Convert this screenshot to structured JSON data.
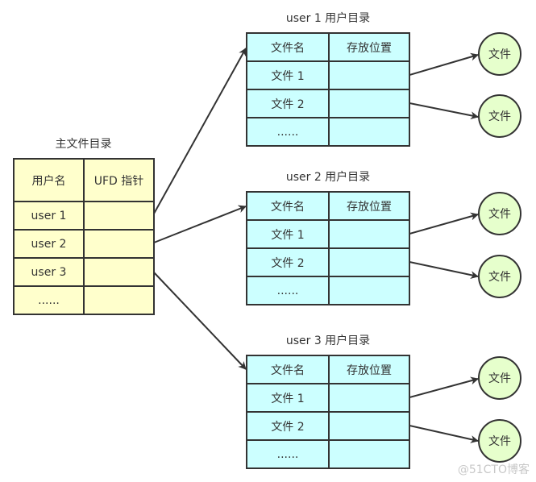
{
  "mfd": {
    "title": "主文件目录",
    "headers": [
      "用户名",
      "UFD 指针"
    ],
    "rows": [
      [
        "user 1",
        ""
      ],
      [
        "user 2",
        ""
      ],
      [
        "user 3",
        ""
      ],
      [
        "......",
        ""
      ]
    ]
  },
  "ufds": [
    {
      "title": "user 1 用户目录",
      "headers": [
        "文件名",
        "存放位置"
      ],
      "rows": [
        [
          "文件 1",
          ""
        ],
        [
          "文件 2",
          ""
        ],
        [
          "......",
          ""
        ]
      ],
      "files": [
        "文件",
        "文件"
      ]
    },
    {
      "title": "user 2 用户目录",
      "headers": [
        "文件名",
        "存放位置"
      ],
      "rows": [
        [
          "文件 1",
          ""
        ],
        [
          "文件 2",
          ""
        ],
        [
          "......",
          ""
        ]
      ],
      "files": [
        "文件",
        "文件"
      ]
    },
    {
      "title": "user 3 用户目录",
      "headers": [
        "文件名",
        "存放位置"
      ],
      "rows": [
        [
          "文件 1",
          ""
        ],
        [
          "文件 2",
          ""
        ],
        [
          "......",
          ""
        ]
      ],
      "files": [
        "文件",
        "文件"
      ]
    }
  ],
  "watermark": "@51CTO博客",
  "colors": {
    "mfd_fill": "#ffffcc",
    "ufd_fill": "#ccffff",
    "file_fill": "#e6ffcc",
    "stroke": "#333333"
  }
}
